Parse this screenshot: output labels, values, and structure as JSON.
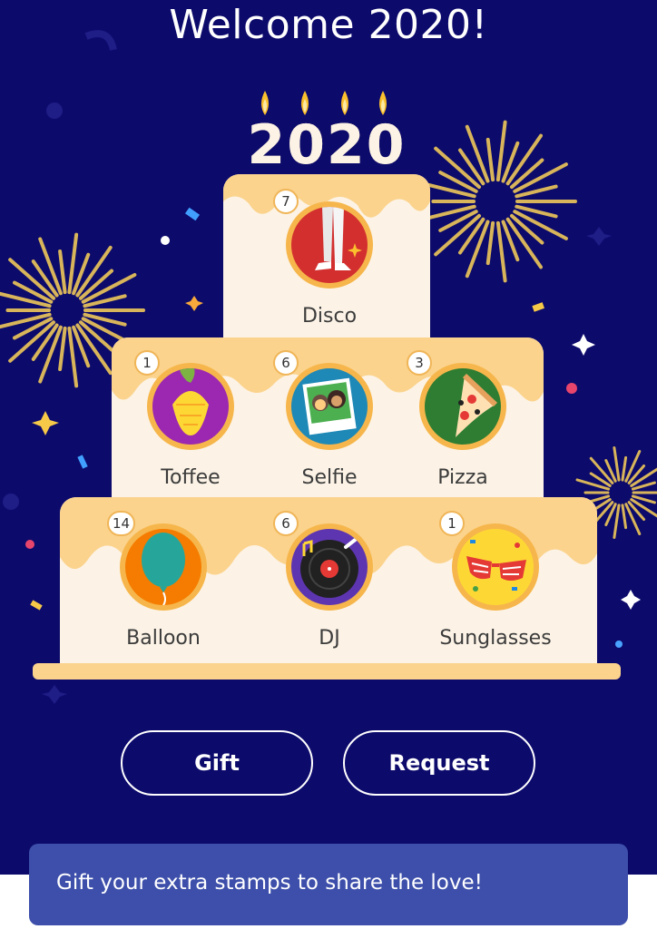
{
  "header": {
    "title": "Welcome 2020!"
  },
  "cake": {
    "year_topper": "2020",
    "tiers": [
      {
        "stamps": [
          {
            "name": "Disco",
            "count": "7",
            "icon": "disco-icon"
          }
        ]
      },
      {
        "stamps": [
          {
            "name": "Toffee",
            "count": "1",
            "icon": "toffee-icon"
          },
          {
            "name": "Selfie",
            "count": "6",
            "icon": "selfie-icon"
          },
          {
            "name": "Pizza",
            "count": "3",
            "icon": "pizza-icon"
          }
        ]
      },
      {
        "stamps": [
          {
            "name": "Balloon",
            "count": "14",
            "icon": "balloon-icon"
          },
          {
            "name": "DJ",
            "count": "6",
            "icon": "dj-record-icon"
          },
          {
            "name": "Sunglasses",
            "count": "1",
            "icon": "sunglasses-icon"
          }
        ]
      }
    ]
  },
  "actions": {
    "gift_label": "Gift",
    "request_label": "Request"
  },
  "snackbar": {
    "text": "Gift your extra stamps to share the love!"
  },
  "colors": {
    "background": "#0c0a6b",
    "cake": "#fcf3e6",
    "frosting": "#fbd38d",
    "snackbar": "#3d4faa",
    "firework": "#d8b55a"
  }
}
